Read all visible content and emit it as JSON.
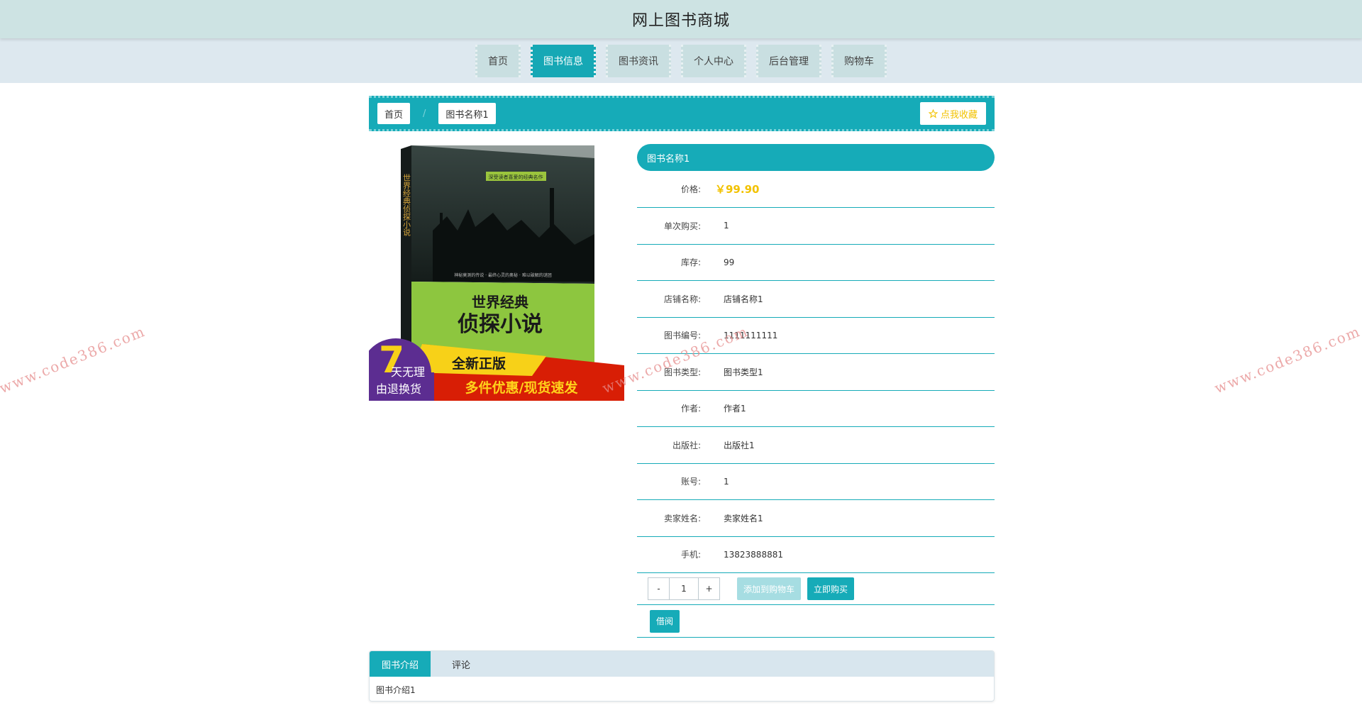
{
  "header": {
    "title": "网上图书商城"
  },
  "nav": [
    {
      "label": "首页",
      "active": false
    },
    {
      "label": "图书信息",
      "active": true
    },
    {
      "label": "图书资讯",
      "active": false
    },
    {
      "label": "个人中心",
      "active": false
    },
    {
      "label": "后台管理",
      "active": false
    },
    {
      "label": "购物车",
      "active": false
    }
  ],
  "breadcrumb": {
    "home": "首页",
    "separator": "/",
    "current": "图书名称1"
  },
  "favorite_label": "点我收藏",
  "cover": {
    "top_banner": "深受读者喜爱的经典名作",
    "vertical_title": "世界经典侦探小说",
    "tagline": "神秘莫测的传说 · 最终心灵的奥秘 · 难以破解的谜团",
    "title_line1": "世界经典",
    "title_line2": "侦探小说",
    "badge_number": "7",
    "badge_line1": "天无理",
    "badge_line2": "由退换货",
    "ribbon_line1": "全新正版",
    "ribbon_line2": "多件优惠/现货速发"
  },
  "detail": {
    "title": "图书名称1",
    "price_label": "价格:",
    "price": "￥99.90",
    "rows": [
      {
        "label": "单次购买:",
        "value": "1"
      },
      {
        "label": "库存:",
        "value": "99"
      },
      {
        "label": "店铺名称:",
        "value": "店铺名称1"
      },
      {
        "label": "图书编号:",
        "value": "1111111111"
      },
      {
        "label": "图书类型:",
        "value": "图书类型1"
      },
      {
        "label": "作者:",
        "value": "作者1"
      },
      {
        "label": "出版社:",
        "value": "出版社1"
      },
      {
        "label": "账号:",
        "value": "1"
      },
      {
        "label": "卖家姓名:",
        "value": "卖家姓名1"
      },
      {
        "label": "手机:",
        "value": "13823888881"
      }
    ]
  },
  "quantity": {
    "minus": "-",
    "value": "1",
    "plus": "+"
  },
  "buttons": {
    "add_to_cart": "添加到购物车",
    "buy_now": "立即购买",
    "borrow": "借阅"
  },
  "tabs": [
    {
      "label": "图书介绍",
      "active": true
    },
    {
      "label": "评论",
      "active": false
    }
  ],
  "tab_content": "图书介绍1",
  "watermark": "www.code386.com",
  "colors": {
    "accent": "#16abb8",
    "header_bg": "#cde3e3",
    "price": "#f2c200"
  }
}
